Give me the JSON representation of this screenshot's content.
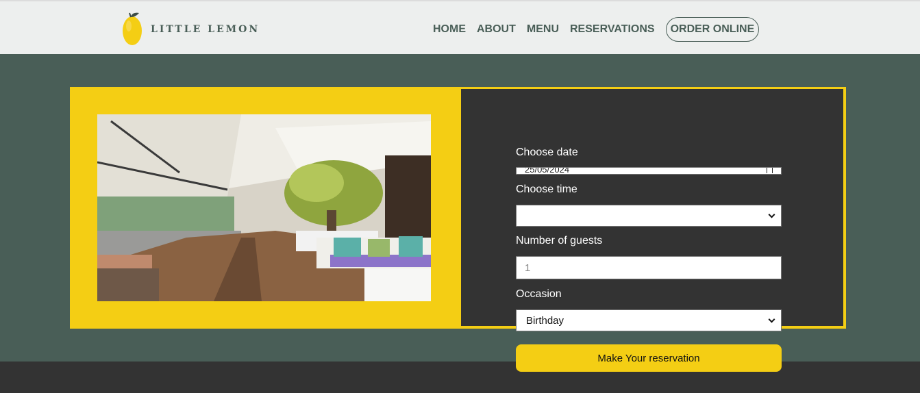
{
  "brand": {
    "name": "LITTLE LEMON"
  },
  "nav": {
    "items": [
      "HOME",
      "ABOUT",
      "MENU",
      "RESERVATIONS"
    ],
    "order_online": "ORDER ONLINE"
  },
  "form": {
    "date_label": "Choose date",
    "date_value": "25/05/2024",
    "time_label": "Choose time",
    "time_value": "",
    "guests_label": "Number of guests",
    "guests_placeholder": "1",
    "occasion_label": "Occasion",
    "occasion_value": "Birthday",
    "submit_label": "Make Your reservation"
  },
  "colors": {
    "primary_green": "#495e57",
    "primary_yellow": "#f4ce14",
    "dark": "#333333",
    "light": "#edefee"
  },
  "icons": [
    "lemon-logo-icon",
    "chevron-down-icon",
    "calendar-icon"
  ]
}
